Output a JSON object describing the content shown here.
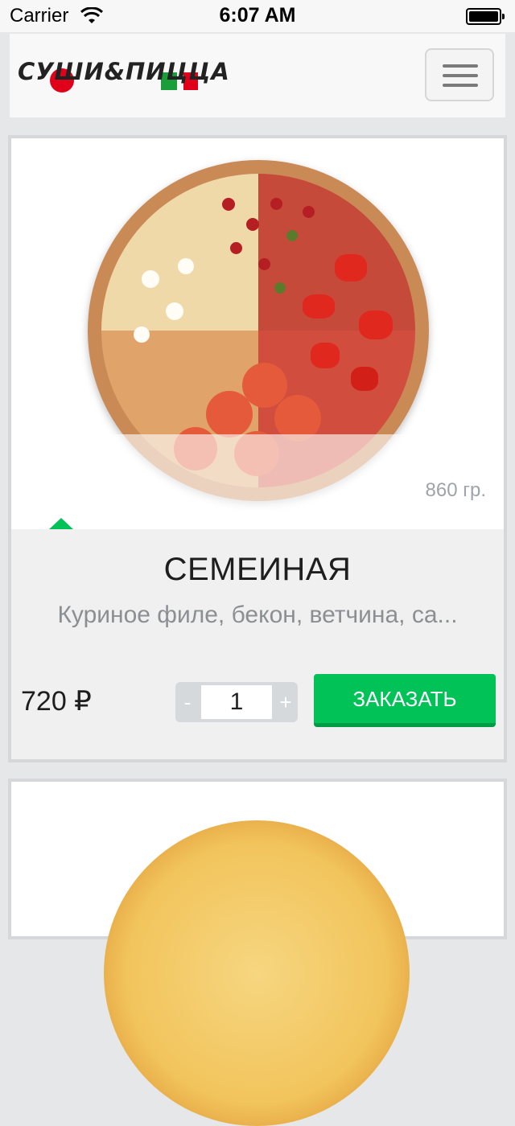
{
  "status_bar": {
    "carrier": "Carrier",
    "time": "6:07 AM",
    "icons": [
      "wifi-icon",
      "battery-icon"
    ]
  },
  "header": {
    "logo_text": "СУШИ&ПИЦЦА",
    "menu_icon": "hamburger-menu-icon"
  },
  "products": [
    {
      "title": "СЕМЕИНАЯ",
      "description": "Куриное филе, бекон, ветчина, са...",
      "weight": "860 гр.",
      "price": "720 ₽",
      "quantity": "1",
      "qty_minus": "-",
      "qty_plus": "+",
      "order_label": "ЗАКАЗАТЬ"
    }
  ],
  "colors": {
    "accent_green": "#00c257",
    "logo_red": "#e1001a",
    "background": "#e6e7e8"
  }
}
